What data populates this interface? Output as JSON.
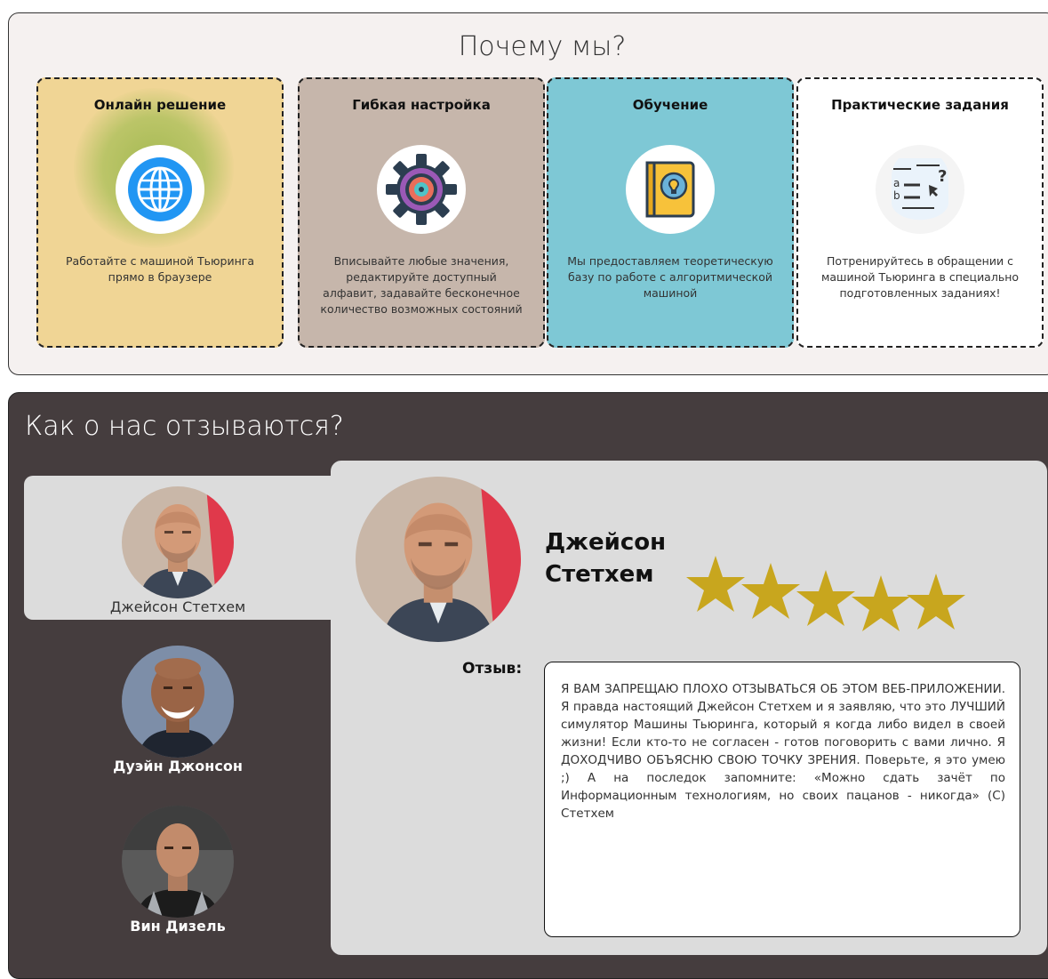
{
  "why_section": {
    "title": "Почему мы?",
    "cards": [
      {
        "title": "Онлайн решение",
        "description": "Работайте с машиной Тьюринга прямо в браузере",
        "icon": "globe-icon",
        "bg": "#f0d595"
      },
      {
        "title": "Гибкая настройка",
        "description": "Вписывайте любые значения, редактируйте доступный алфавит, задавайте бесконечное количество возможных состояний",
        "icon": "gear-icon",
        "bg": "#c6b6ab"
      },
      {
        "title": "Обучение",
        "description": "Мы предоставляем теоретическую базу по работе с алгоритмической машиной",
        "icon": "lightbulb-book-icon",
        "bg": "#7ec8d5"
      },
      {
        "title": "Практические задания",
        "description": "Потренируйтесь в обращении с машиной Тьюринга в специально подготовленных заданиях!",
        "icon": "quiz-icon",
        "bg": "#ffffff"
      }
    ]
  },
  "reviews_section": {
    "title": "Как о нас отзываются?",
    "people": [
      {
        "name": "Джейсон Стетхем",
        "active": true
      },
      {
        "name": "Дуэйн Джонсон",
        "active": false
      },
      {
        "name": "Вин Дизель",
        "active": false
      }
    ],
    "selected": {
      "name": "Джейсон Стетхем",
      "rating": 5,
      "review_label": "Отзыв:",
      "review_text": "Я ВАМ ЗАПРЕЩАЮ ПЛОХО ОТЗЫВАТЬСЯ ОБ ЭТОМ ВЕБ-ПРИЛОЖЕНИИ. Я правда настоящий Джейсон Стетхем и я заявляю, что это ЛУЧШИЙ симулятор Машины Тьюринга, который я когда либо видел в своей жизни! Если кто-то не согласен - готов поговорить с вами лично. Я ДОХОДЧИВО ОБЪЯСНЮ СВОЮ ТОЧКУ ЗРЕНИЯ. Поверьте, я это умею ;) А на последок запомните: «Можно сдать зачёт по Информационным технологиям, но своих пацанов - никогда» (С) Стетхем"
    },
    "star_color": "#c8a61e"
  }
}
